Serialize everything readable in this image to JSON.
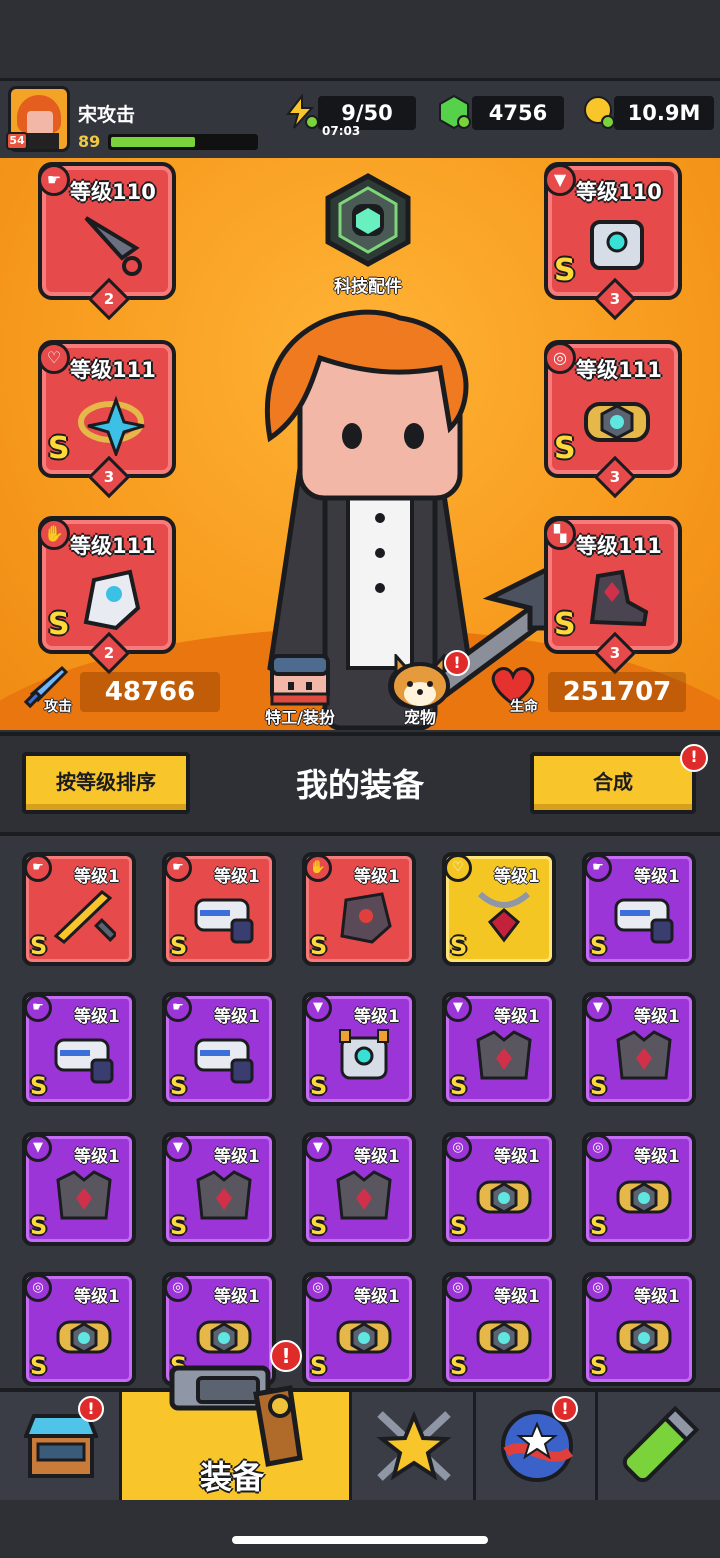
{
  "player": {
    "name": "宋攻击",
    "level": "89",
    "badge_level": "54",
    "xp_fraction": 0.58
  },
  "resources": {
    "energy": "9/50",
    "energy_timer": "07:03",
    "gems": "4756",
    "coins": "10.9M"
  },
  "hero": {
    "center_label": "科技配件"
  },
  "equip_slots": {
    "left": [
      {
        "label": "等级110",
        "count": "2",
        "grade": "",
        "type": "weapon-icon"
      },
      {
        "label": "等级111",
        "count": "3",
        "grade": "S",
        "type": "necklace-icon"
      },
      {
        "label": "等级111",
        "count": "2",
        "grade": "S",
        "type": "glove-icon"
      }
    ],
    "right": [
      {
        "label": "等级110",
        "count": "3",
        "grade": "S",
        "type": "armor-icon"
      },
      {
        "label": "等级111",
        "count": "3",
        "grade": "S",
        "type": "belt-icon"
      },
      {
        "label": "等级111",
        "count": "3",
        "grade": "S",
        "type": "boot-icon"
      }
    ]
  },
  "stats": {
    "attack_label": "攻击",
    "attack": "48766",
    "agent_label": "特工/装扮",
    "pet_label": "宠物",
    "hp_label": "生命",
    "hp": "251707"
  },
  "inventory": {
    "sort_button": "按等级排序",
    "title": "我的装备",
    "merge_button": "合成",
    "items": [
      {
        "label": "等级1",
        "grade": "S",
        "rarity": "red",
        "icon": "weapon-icon",
        "art": "sword"
      },
      {
        "label": "等级1",
        "grade": "S",
        "rarity": "red",
        "icon": "weapon-icon",
        "art": "gun"
      },
      {
        "label": "等级1",
        "grade": "S",
        "rarity": "red",
        "icon": "glove-icon",
        "art": "gauntlet"
      },
      {
        "label": "等级1",
        "grade": "S",
        "rarity": "gold",
        "icon": "necklace-icon",
        "art": "necklace"
      },
      {
        "label": "等级1",
        "grade": "S",
        "rarity": "purple",
        "icon": "weapon-icon",
        "art": "gun"
      },
      {
        "label": "等级1",
        "grade": "S",
        "rarity": "purple",
        "icon": "weapon-icon",
        "art": "gun"
      },
      {
        "label": "等级1",
        "grade": "S",
        "rarity": "purple",
        "icon": "weapon-icon",
        "art": "gun"
      },
      {
        "label": "等级1",
        "grade": "S",
        "rarity": "purple",
        "icon": "armor-icon",
        "art": "robot"
      },
      {
        "label": "等级1",
        "grade": "S",
        "rarity": "purple",
        "icon": "armor-icon",
        "art": "armor"
      },
      {
        "label": "等级1",
        "grade": "S",
        "rarity": "purple",
        "icon": "armor-icon",
        "art": "armor"
      },
      {
        "label": "等级1",
        "grade": "S",
        "rarity": "purple",
        "icon": "armor-icon",
        "art": "armor"
      },
      {
        "label": "等级1",
        "grade": "S",
        "rarity": "purple",
        "icon": "armor-icon",
        "art": "armor"
      },
      {
        "label": "等级1",
        "grade": "S",
        "rarity": "purple",
        "icon": "armor-icon",
        "art": "armor"
      },
      {
        "label": "等级1",
        "grade": "S",
        "rarity": "purple",
        "icon": "belt-icon",
        "art": "belt"
      },
      {
        "label": "等级1",
        "grade": "S",
        "rarity": "purple",
        "icon": "belt-icon",
        "art": "belt"
      },
      {
        "label": "等级1",
        "grade": "S",
        "rarity": "purple",
        "icon": "belt-icon",
        "art": "belt"
      },
      {
        "label": "等级1",
        "grade": "S",
        "rarity": "purple",
        "icon": "belt-icon",
        "art": "belt"
      },
      {
        "label": "等级1",
        "grade": "S",
        "rarity": "purple",
        "icon": "belt-icon",
        "art": "belt"
      },
      {
        "label": "等级1",
        "grade": "S",
        "rarity": "purple",
        "icon": "belt-icon",
        "art": "belt"
      },
      {
        "label": "等级1",
        "grade": "S",
        "rarity": "purple",
        "icon": "belt-icon",
        "art": "belt"
      }
    ]
  },
  "nav": {
    "active_label": "装备",
    "notice_mark": "!"
  },
  "colors": {
    "orange_bg": "#f79b1e",
    "red_card": "#e64a4a",
    "purple_card": "#9c35d8",
    "gold_card": "#f3c624",
    "button_yellow": "#f8c52b"
  }
}
